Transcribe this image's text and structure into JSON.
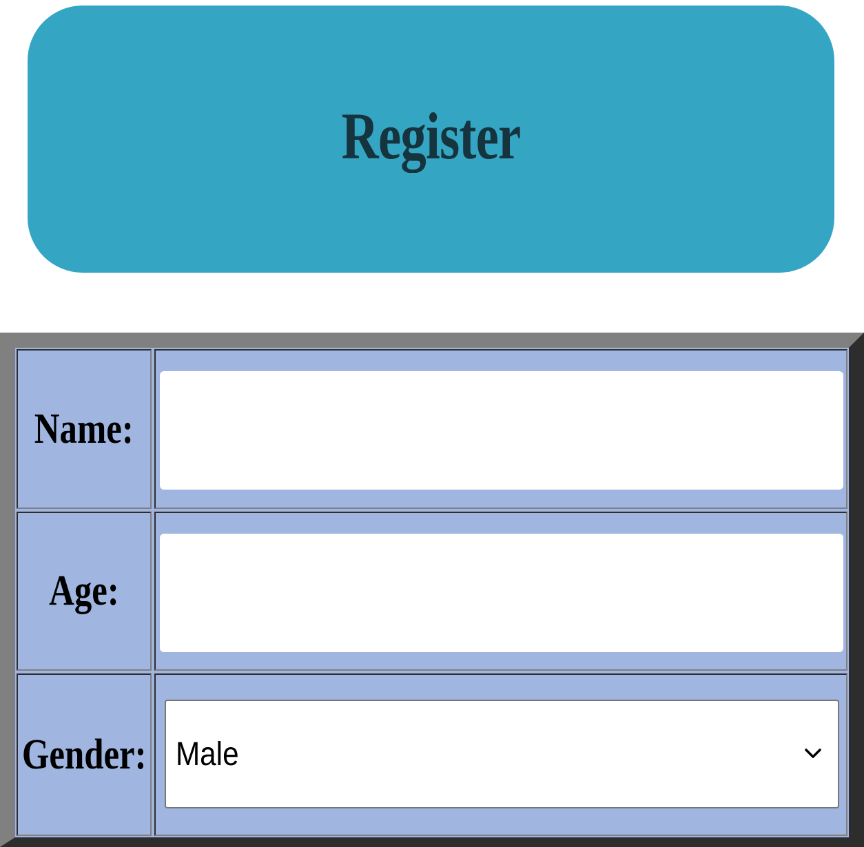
{
  "header": {
    "title": "Register",
    "background_color": "#35a5c4",
    "text_color": "#15343e"
  },
  "form": {
    "background_color": "#a0b6e0",
    "fields": [
      {
        "label": "Name:",
        "type": "text",
        "value": "",
        "placeholder": ""
      },
      {
        "label": "Age:",
        "type": "text",
        "value": "",
        "placeholder": ""
      },
      {
        "label": "Gender:",
        "type": "select",
        "value": "Male",
        "icon": "chevron-down-icon"
      }
    ]
  }
}
